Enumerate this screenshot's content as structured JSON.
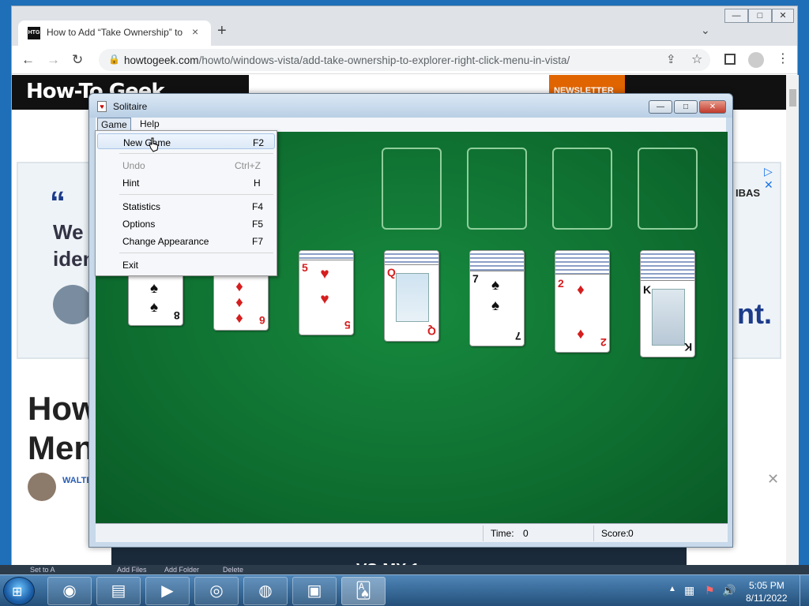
{
  "browser": {
    "tab_title": "How to Add “Take Ownership” to",
    "tab_favicon": "HTG",
    "url_host": "howtogeek.com",
    "url_path": "/howto/windows-vista/add-take-ownership-to-explorer-right-click-menu-in-vista/",
    "new_tab_icon": "+",
    "close_tab_icon": "×",
    "tab_search_icon": "⌄",
    "back_icon": "←",
    "forward_icon": "→",
    "reload_icon": "↻",
    "lock_icon": "🔒",
    "share_icon": "⇪",
    "star_icon": "☆",
    "menu_icon": "⋮",
    "win_min": "—",
    "win_max": "□",
    "win_close": "✕"
  },
  "page": {
    "logo": "How-To Geek",
    "newsletter": "NEWSLETTER",
    "ad_quote": "“",
    "ad_text_line1": "We i",
    "ad_text_line2": "iden",
    "ad_right_text": "IBAS",
    "ad_logo_fragment": "nt.",
    "headline_line1": "How",
    "headline_line2": "Men",
    "author": "WALTE",
    "bottom_text": "VS-MX 1"
  },
  "solitaire": {
    "title": "Solitaire",
    "window_icon": "♥",
    "menus": [
      "Game",
      "Help"
    ],
    "btn_min": "—",
    "btn_max": "□",
    "btn_close": "✕",
    "status": {
      "time_label": "Time:",
      "time_value": "0",
      "score_label": "Score:",
      "score_value": "0"
    },
    "tableau": [
      {
        "rank": "8",
        "suit": "♠",
        "color": "blk"
      },
      {
        "rank": "6",
        "suit": "♦",
        "color": "red"
      },
      {
        "rank": "5",
        "suit": "♥",
        "color": "red"
      },
      {
        "rank": "Q",
        "suit": "♦",
        "color": "red"
      },
      {
        "rank": "7",
        "suit": "♠",
        "color": "blk"
      },
      {
        "rank": "2",
        "suit": "♦",
        "color": "red"
      },
      {
        "rank": "K",
        "suit": "♠",
        "color": "blk"
      }
    ]
  },
  "game_menu": {
    "items": [
      {
        "label": "New Game",
        "key": "F2"
      },
      {
        "label": "Undo",
        "key": "Ctrl+Z"
      },
      {
        "label": "Hint",
        "key": "H"
      },
      {
        "label": "Statistics",
        "key": "F4"
      },
      {
        "label": "Options",
        "key": "F5"
      },
      {
        "label": "Change Appearance",
        "key": "F7"
      },
      {
        "label": "Exit",
        "key": ""
      }
    ]
  },
  "taskbar": {
    "start_icon": "⊞",
    "apps": [
      {
        "name": "chrome",
        "icon": "◉"
      },
      {
        "name": "explorer",
        "icon": "▤"
      },
      {
        "name": "media-player",
        "icon": "▶"
      },
      {
        "name": "music",
        "icon": "◎"
      },
      {
        "name": "speaker",
        "icon": "◍"
      },
      {
        "name": "system-monitor",
        "icon": "▣"
      },
      {
        "name": "solitaire",
        "icon": "🂡"
      }
    ],
    "tray_arrow": "▲",
    "tray_network": "▦",
    "tray_flag": "⚑",
    "tray_volume": "🔊",
    "clock_time": "5:05 PM",
    "clock_date": "8/11/2022"
  },
  "behind": {
    "labels": [
      "Set to A",
      "Add Files",
      "Add Folder",
      "Delete"
    ]
  }
}
